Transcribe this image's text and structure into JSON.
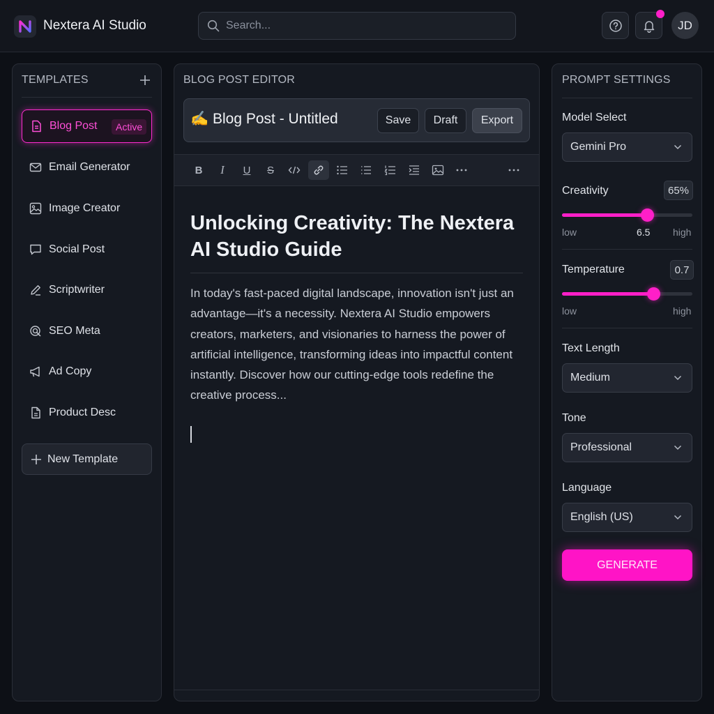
{
  "header": {
    "app_title": "Nextera AI Studio",
    "search_placeholder": "Search...",
    "avatar_initials": "JD",
    "has_notification": true
  },
  "templates": {
    "title": "TEMPLATES",
    "active_badge": "Active",
    "items": [
      {
        "label": "Blog Post",
        "icon": "document-icon",
        "active": true
      },
      {
        "label": "Email Generator",
        "icon": "mail-icon"
      },
      {
        "label": "Image Creator",
        "icon": "image-icon"
      },
      {
        "label": "Social Post",
        "icon": "chat-bubble-icon"
      },
      {
        "label": "Scriptwriter",
        "icon": "pencil-icon"
      },
      {
        "label": "SEO Meta",
        "icon": "seo-search-icon"
      },
      {
        "label": "Ad Copy",
        "icon": "megaphone-icon"
      },
      {
        "label": "Product Desc",
        "icon": "file-text-icon"
      }
    ],
    "new_template_label": "New Template"
  },
  "editor": {
    "panel_title": "BLOG POST EDITOR",
    "doc_title": "✍️ Blog Post - Untitled",
    "buttons": {
      "save": "Save",
      "draft": "Draft",
      "export": "Export"
    },
    "toolbar": [
      "bold",
      "italic",
      "underline",
      "strikethrough",
      "code",
      "link",
      "bulleted-list",
      "list",
      "numbered-list",
      "indent",
      "image",
      "more",
      "overflow"
    ],
    "heading": "Unlocking Creativity: The Nextera AI Studio Guide",
    "body": "In today's fast-paced digital landscape, innovation isn't just an advantage—it's a necessity. Nextera AI Studio empowers creators, marketers, and visionaries to harness the power of artificial intelligence, transforming ideas into impactful content instantly. Discover how our cutting-edge tools redefine the creative process..."
  },
  "settings": {
    "title": "PROMPT SETTINGS",
    "model": {
      "label": "Model Select",
      "value": "Gemini Pro"
    },
    "creativity": {
      "label": "Creativity",
      "value_text": "65%",
      "value": 0.65,
      "low": "low",
      "mid": "6.5",
      "high": "high"
    },
    "temperature": {
      "label": "Temperature",
      "value_text": "0.7",
      "value": 0.7,
      "low": "low",
      "high": "high"
    },
    "text_length": {
      "label": "Text Length",
      "value": "Medium"
    },
    "tone": {
      "label": "Tone",
      "value": "Professional"
    },
    "language": {
      "label": "Language",
      "value": "English (US)"
    },
    "generate_label": "GENERATE"
  },
  "colors": {
    "accent": "#ff1fc8",
    "background": "#0d1016",
    "panel": "#151921"
  }
}
